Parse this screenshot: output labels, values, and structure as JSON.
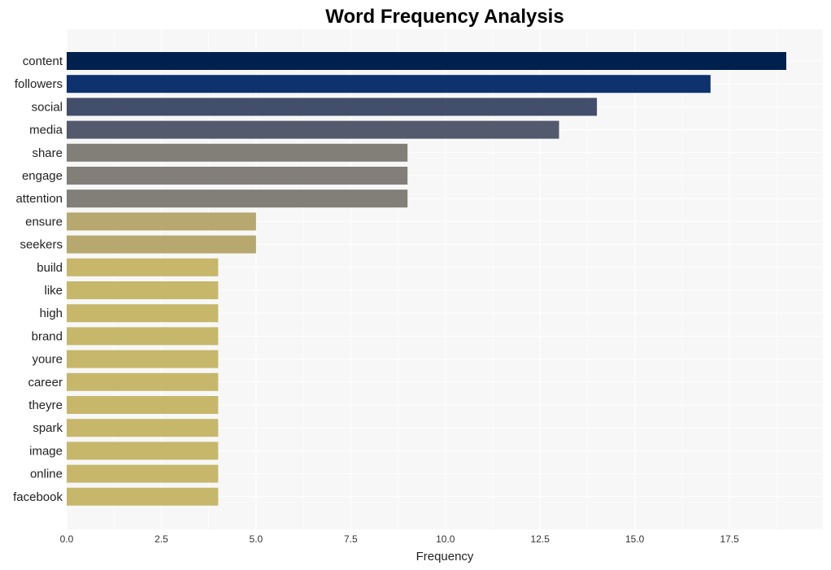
{
  "chart_data": {
    "type": "bar",
    "orientation": "horizontal",
    "title": "Word Frequency Analysis",
    "xlabel": "Frequency",
    "ylabel": "",
    "xlim": [
      0,
      19.9
    ],
    "xticks": [
      0,
      2.5,
      5,
      7.5,
      10,
      12.5,
      15,
      17.5
    ],
    "xtick_labels": [
      "0.0",
      "2.5",
      "5.0",
      "7.5",
      "10.0",
      "12.5",
      "15.0",
      "17.5"
    ],
    "grid": true,
    "legend": "none",
    "categories": [
      "content",
      "followers",
      "social",
      "media",
      "share",
      "engage",
      "attention",
      "ensure",
      "seekers",
      "build",
      "like",
      "high",
      "brand",
      "youre",
      "career",
      "theyre",
      "spark",
      "image",
      "online",
      "facebook"
    ],
    "values": [
      19,
      17,
      14,
      13,
      9,
      9,
      9,
      5,
      5,
      4,
      4,
      4,
      4,
      4,
      4,
      4,
      4,
      4,
      4,
      4
    ],
    "colors": [
      "#00204d",
      "#0d326e",
      "#434e6b",
      "#535a6e",
      "#817f78",
      "#817f78",
      "#817f78",
      "#b6a86e",
      "#b6a86e",
      "#c6b76b",
      "#c6b76b",
      "#c6b76b",
      "#c6b76b",
      "#c6b76b",
      "#c6b76b",
      "#c6b76b",
      "#c6b76b",
      "#c6b76b",
      "#c6b76b",
      "#c6b76b"
    ],
    "plot_background": "#f7f7f7",
    "grid_color": "#ffffff"
  }
}
